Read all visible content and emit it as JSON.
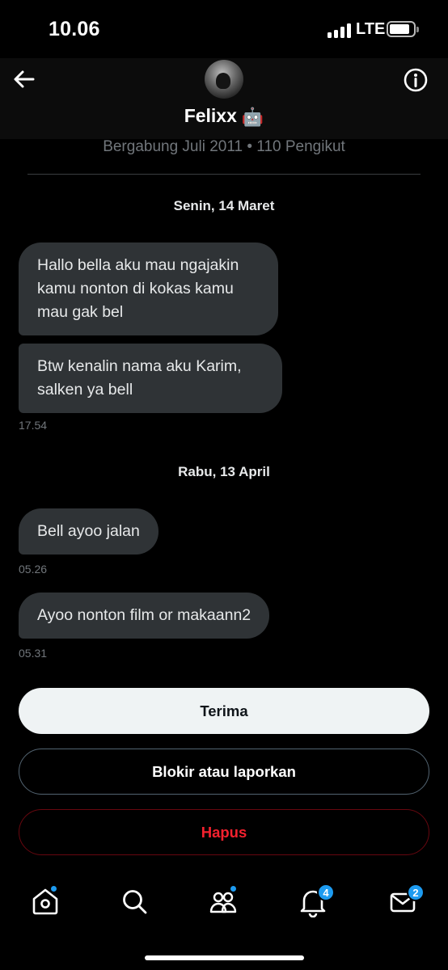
{
  "status_bar": {
    "time": "10.06",
    "network": "LTE"
  },
  "header": {
    "name": "Felixx",
    "name_emoji": "🤖",
    "back_icon": "arrow-left-icon",
    "info_icon": "info-circle-icon"
  },
  "profile_meta": "Bergabung Juli 2011 • 110 Pengikut",
  "conversation": [
    {
      "date": "Senin, 14 Maret",
      "messages": [
        {
          "text": "Hallo bella aku mau ngajakin kamu nonton di kokas kamu mau gak bel"
        },
        {
          "text": "Btw kenalin nama aku Karim, salken ya bell",
          "time": "17.54"
        }
      ]
    },
    {
      "date": "Rabu, 13 April",
      "messages": [
        {
          "text": "Bell ayoo jalan",
          "time": "05.26"
        },
        {
          "text": "Ayoo nonton film or makaann2",
          "time": "05.31"
        }
      ]
    }
  ],
  "actions": {
    "accept": "Terima",
    "block_report": "Blokir atau laporkan",
    "delete": "Hapus"
  },
  "tabbar": {
    "home": {
      "icon": "home-icon",
      "has_dot": true
    },
    "search": {
      "icon": "search-icon"
    },
    "communities": {
      "icon": "communities-icon",
      "has_dot": true
    },
    "notifications": {
      "icon": "bell-icon",
      "badge": "4"
    },
    "messages": {
      "icon": "mail-icon",
      "badge": "2"
    }
  },
  "colors": {
    "background": "#000000",
    "bubble": "#2f3336",
    "accent": "#1d9bf0",
    "danger": "#f4212e",
    "muted": "#71767b"
  }
}
